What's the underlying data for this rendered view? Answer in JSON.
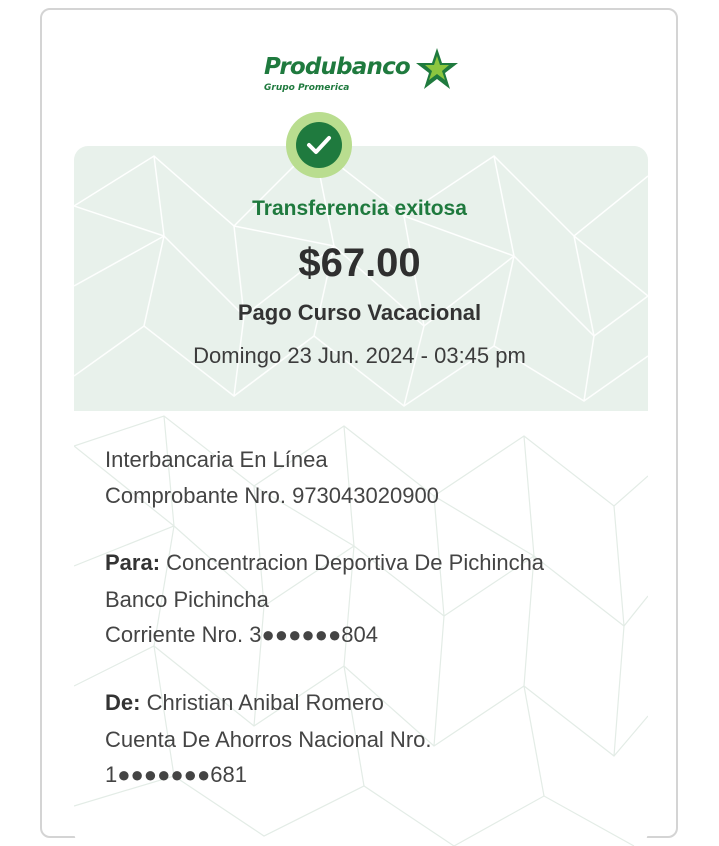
{
  "brand": {
    "name": "Produbanco",
    "subtitle": "Grupo Promerica"
  },
  "receipt": {
    "status": "Transferencia exitosa",
    "amount": "$67.00",
    "concept": "Pago Curso Vacacional",
    "datetime": "Domingo 23 Jun. 2024 - 03:45 pm",
    "transfer_type": "Interbancaria En Línea",
    "voucher": "Comprobante Nro. 973043020900",
    "to_label": "Para:",
    "to_name": "Concentracion Deportiva De Pichincha",
    "to_bank": "Banco Pichincha",
    "to_account": "Corriente Nro. 3●●●●●●804",
    "from_label": "De:",
    "from_name": "Christian Anibal Romero",
    "from_account_type": "Cuenta De Ahorros Nacional Nro.",
    "from_account": "1●●●●●●●681"
  },
  "colors": {
    "brand_green": "#1f7a3e",
    "check_ring": "#b9dd8f",
    "header_bg": "#e8f1eb"
  },
  "icons": [
    "produbanco-star-icon",
    "check-icon"
  ]
}
